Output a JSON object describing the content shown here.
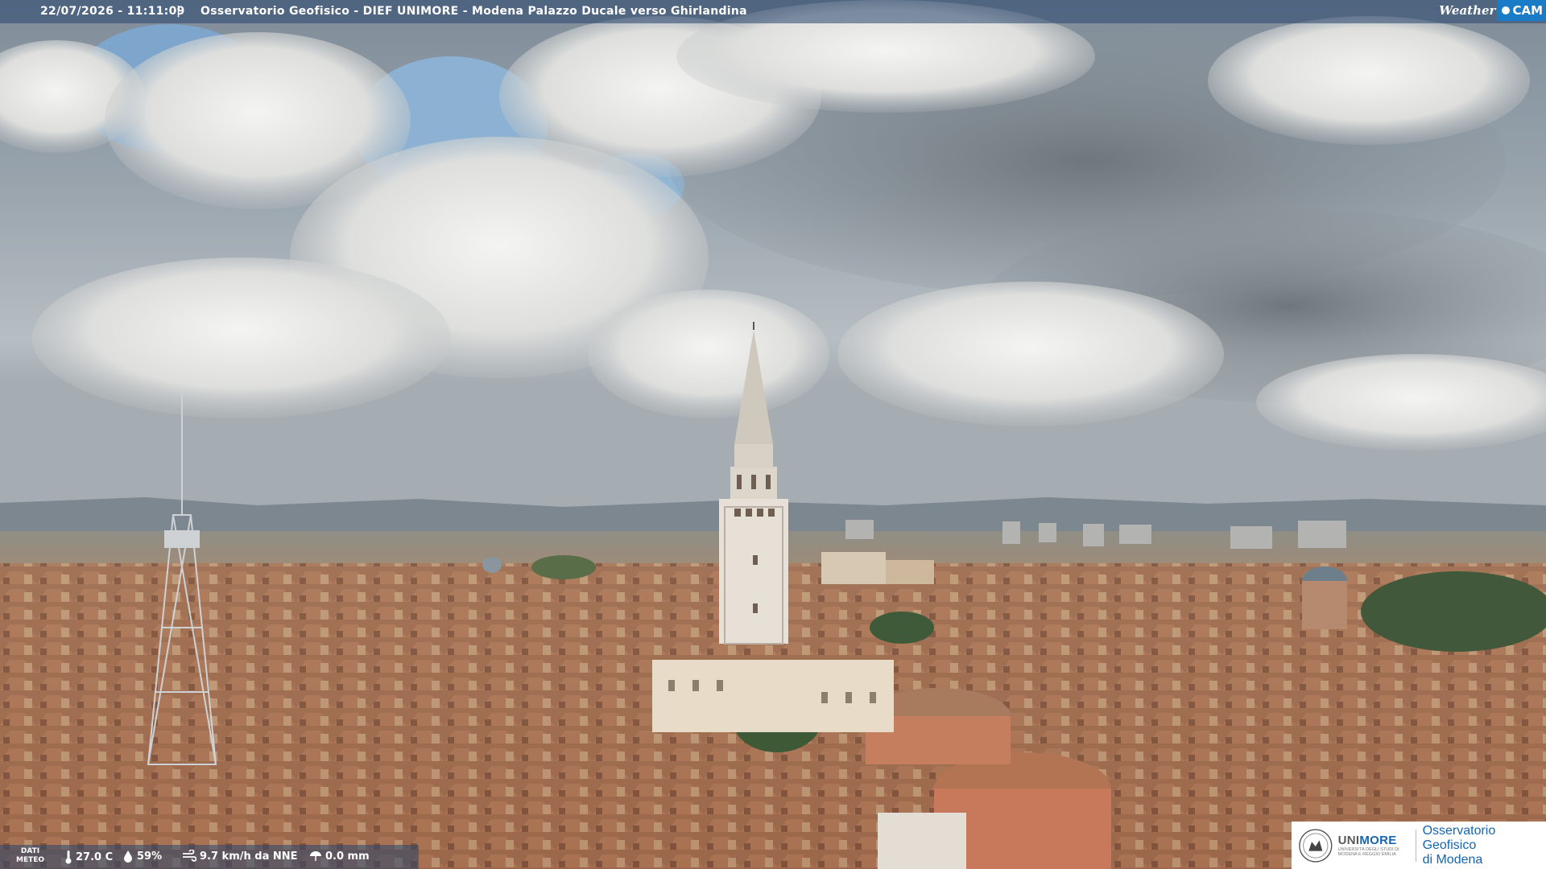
{
  "overlay": {
    "timestamp": "22/07/2026 - 11:11:09",
    "separator": "|",
    "location_title": "Osservatorio Geofisico - DIEF UNIMORE - Modena Palazzo Ducale verso Ghirlandina",
    "brand_word": "Weather",
    "brand_badge": "CAM"
  },
  "weather_bar": {
    "label_line1": "DATI",
    "label_line2": "METEO",
    "temperature": "27.0 C",
    "humidity": "59%",
    "wind": "9.7 km/h da NNE",
    "rain": "0.0 mm"
  },
  "logo": {
    "university_part1": "UNI",
    "university_part2": "MORE",
    "university_sub": "UNIVERSITÀ DEGLI STUDI DI MODENA E REGGIO EMILIA",
    "observatory_line1": "Osservatorio Geofisico",
    "observatory_line2": "di Modena",
    "brand_color": "#1565b0"
  },
  "colors": {
    "bar_background": "rgba(40,70,110,0.55)",
    "cam_badge": "#1a7bc6",
    "roof_terracotta": "#a86b4a",
    "tower_stone": "#e6e0d6"
  }
}
